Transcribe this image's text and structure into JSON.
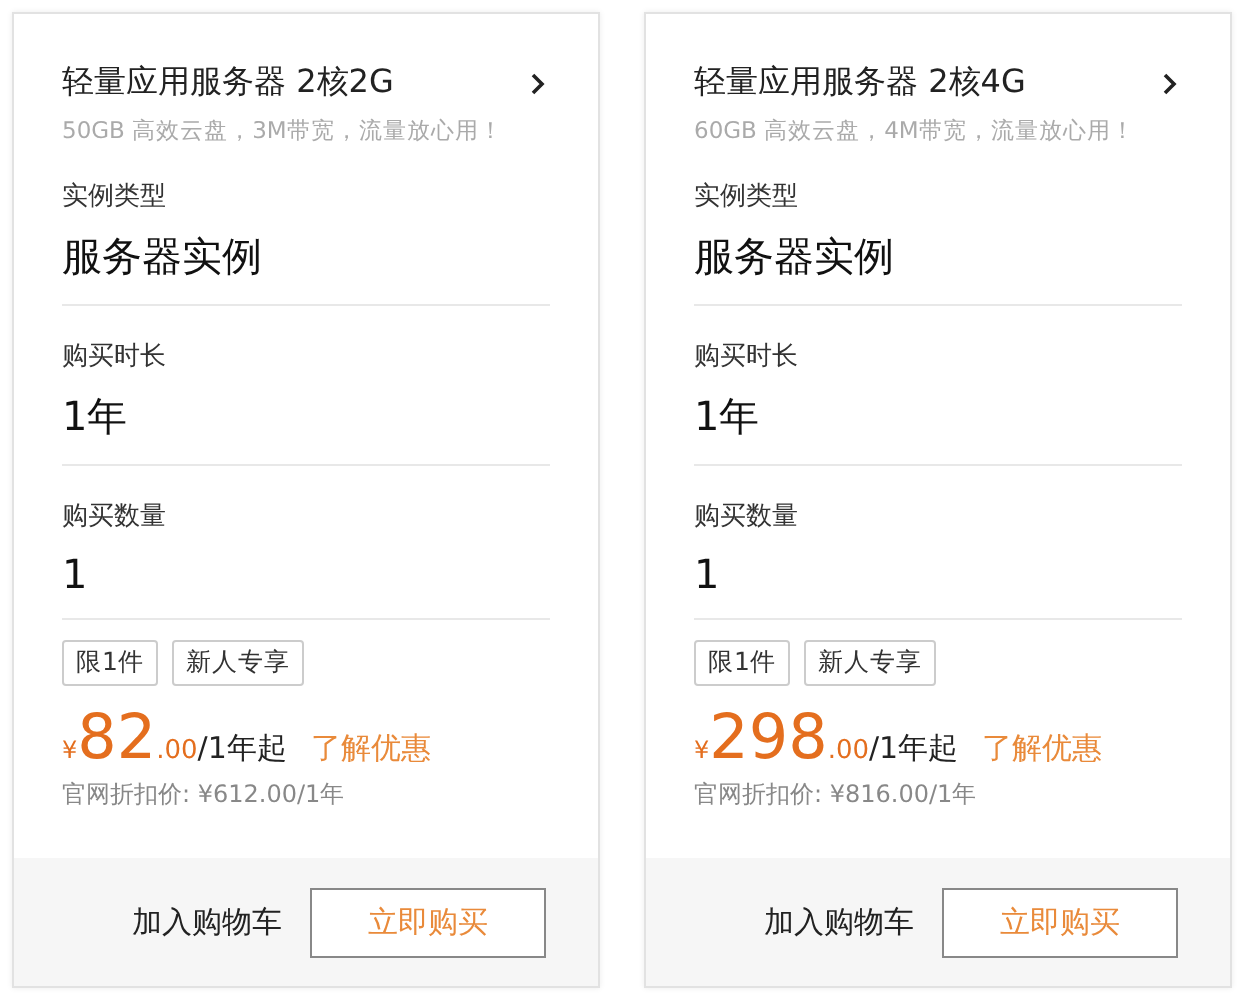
{
  "cards": [
    {
      "title": "轻量应用服务器 2核2G",
      "subtitle": "50GB 高效云盘，3M带宽，流量放心用！",
      "fields": [
        {
          "label": "实例类型",
          "value": "服务器实例"
        },
        {
          "label": "购买时长",
          "value": "1年"
        },
        {
          "label": "购买数量",
          "value": "1"
        }
      ],
      "tags": [
        "限1件",
        "新人专享"
      ],
      "price": {
        "currency": "¥",
        "integer": "82",
        "decimal": ".00",
        "unit": "/1年起",
        "link": "了解优惠"
      },
      "list_price": "官网折扣价: ¥612.00/1年",
      "buttons": {
        "cart": "加入购物车",
        "buy": "立即购买"
      }
    },
    {
      "title": "轻量应用服务器 2核4G",
      "subtitle": "60GB 高效云盘，4M带宽，流量放心用！",
      "fields": [
        {
          "label": "实例类型",
          "value": "服务器实例"
        },
        {
          "label": "购买时长",
          "value": "1年"
        },
        {
          "label": "购买数量",
          "value": "1"
        }
      ],
      "tags": [
        "限1件",
        "新人专享"
      ],
      "price": {
        "currency": "¥",
        "integer": "298",
        "decimal": ".00",
        "unit": "/1年起",
        "link": "了解优惠"
      },
      "list_price": "官网折扣价: ¥816.00/1年",
      "buttons": {
        "cart": "加入购物车",
        "buy": "立即购买"
      }
    }
  ]
}
